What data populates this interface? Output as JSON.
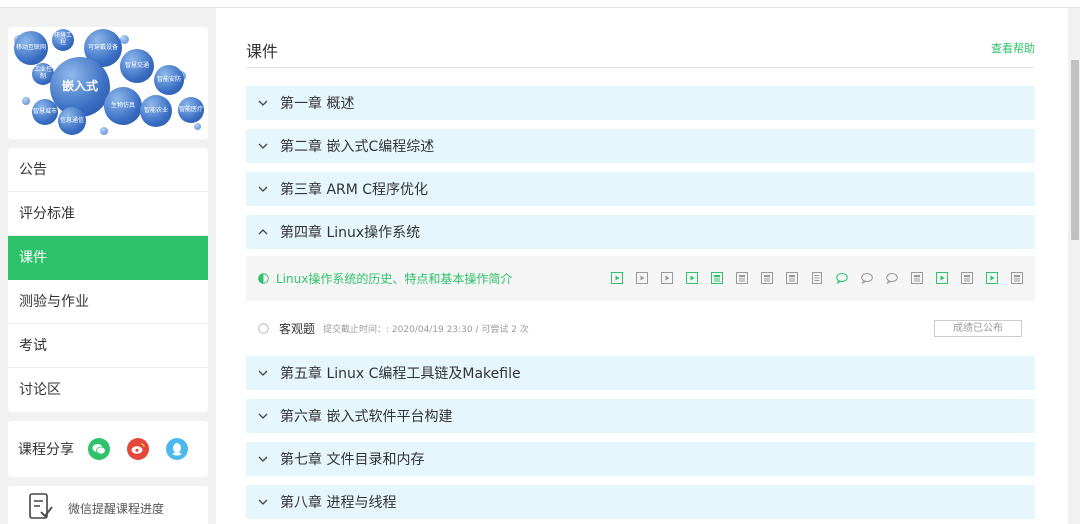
{
  "banner": {
    "center": "嵌入式",
    "bubbles": [
      "移动互联网",
      "环境工程",
      "可穿戴设备",
      "工业控制",
      "智慧交通",
      "智能安防",
      "生物仿真",
      "智慧城市",
      "信息通信",
      "智能农业",
      "智能医疗"
    ]
  },
  "menu": {
    "items": [
      {
        "label": "公告"
      },
      {
        "label": "评分标准"
      },
      {
        "label": "课件"
      },
      {
        "label": "测验与作业"
      },
      {
        "label": "考试"
      },
      {
        "label": "讨论区"
      }
    ]
  },
  "share": {
    "label": "课程分享",
    "colors": {
      "wechat": "#2ec26b",
      "weibo": "#e6473b",
      "qq": "#4bb8ee"
    }
  },
  "remind": {
    "label": "微信提醒课程进度"
  },
  "main": {
    "title": "课件",
    "help": "查看帮助",
    "chapters": [
      {
        "title": "第一章 概述"
      },
      {
        "title": "第二章 嵌入式C编程综述"
      },
      {
        "title": "第三章 ARM C程序优化"
      },
      {
        "title": "第四章 Linux操作系统"
      },
      {
        "title": "第五章 Linux C编程工具链及Makefile"
      },
      {
        "title": "第六章 嵌入式软件平台构建"
      },
      {
        "title": "第七章 文件目录和内存"
      },
      {
        "title": "第八章 进程与线程"
      }
    ],
    "lesson": {
      "title": "Linux操作系统的历史、特点和基本操作简介",
      "resources": [
        "video",
        "video",
        "video",
        "video",
        "doc",
        "doc",
        "doc",
        "doc",
        "text",
        "discussion",
        "discussion",
        "discussion",
        "doc",
        "video",
        "doc",
        "video",
        "doc"
      ]
    },
    "quiz": {
      "name": "客观题",
      "meta": "提交截止时间：: 2020/04/19 23:30 / 可尝试 2 次",
      "status": "成绩已公布"
    }
  },
  "colors": {
    "accent": "#2ec26b",
    "chapter_bg": "#e6f6fd"
  }
}
